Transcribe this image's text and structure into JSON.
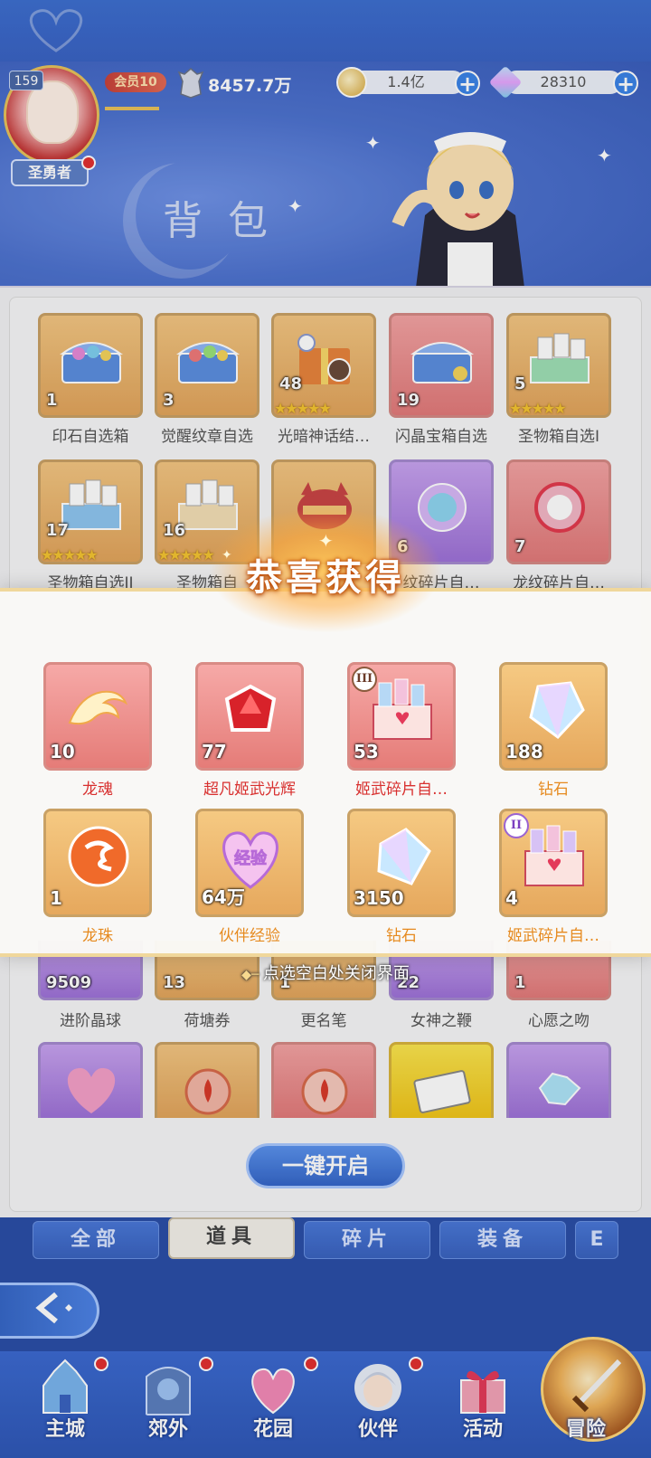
{
  "header": {
    "level": "159",
    "vip": "会员10",
    "power": "8457.7万",
    "gold": "1.4亿",
    "gems": "28310",
    "rank": "圣勇者",
    "title": "背包"
  },
  "inventory": {
    "row1": [
      {
        "count": "1",
        "label": "印石自选箱"
      },
      {
        "count": "3",
        "label": "觉醒纹章自选"
      },
      {
        "count": "48",
        "label": "光暗神话结…"
      },
      {
        "count": "19",
        "label": "闪晶宝箱自选"
      },
      {
        "count": "5",
        "label": "圣物箱自选I"
      }
    ],
    "row2": [
      {
        "count": "17",
        "label": "圣物箱自选II"
      },
      {
        "count": "16",
        "label": "圣物箱自"
      },
      {
        "count": "",
        "label": ""
      },
      {
        "count": "6",
        "label": "纹碎片自…"
      },
      {
        "count": "7",
        "label": "龙纹碎片自…"
      }
    ],
    "row_hidden": [
      {
        "count": "9509",
        "label": "进阶晶球"
      },
      {
        "count": "13",
        "label": "荷塘券"
      },
      {
        "count": "1",
        "label": "更名笔"
      },
      {
        "count": "22",
        "label": "女神之鞭"
      },
      {
        "count": "1",
        "label": "心愿之吻"
      }
    ],
    "open_all": "一键开启"
  },
  "tabs": [
    "全部",
    "道具",
    "碎片",
    "装备",
    "E"
  ],
  "popup": {
    "title": "恭喜获得",
    "close_hint": "点选空白处关闭界面",
    "rewards": [
      {
        "count": "10",
        "label": "龙魂"
      },
      {
        "count": "77",
        "label": "超凡姬武光辉"
      },
      {
        "count": "53",
        "label": "姬武碎片自…",
        "grade": "III"
      },
      {
        "count": "188",
        "label": "钻石"
      },
      {
        "count": "1",
        "label": "龙珠"
      },
      {
        "count": "64万",
        "label": "伙伴经验"
      },
      {
        "count": "3150",
        "label": "钻石"
      },
      {
        "count": "4",
        "label": "姬武碎片自…",
        "grade": "II"
      }
    ],
    "exp_art_text": "经验"
  },
  "nav": [
    "主城",
    "郊外",
    "花园",
    "伙伴",
    "活动",
    "冒险"
  ]
}
